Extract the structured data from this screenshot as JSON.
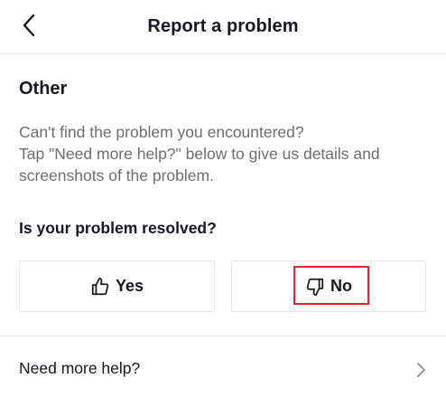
{
  "header": {
    "title": "Report a problem",
    "back_icon": "chevron-left-icon"
  },
  "section": {
    "title": "Other",
    "description_lines": [
      "Can't find the problem you encountered?",
      "Tap \"Need more help?\" below to give us details and",
      "screenshots of the problem."
    ]
  },
  "feedback": {
    "question": "Is your problem resolved?",
    "yes_label": "Yes",
    "yes_icon": "thumbs-up-icon",
    "no_label": "No",
    "no_icon": "thumbs-down-icon",
    "highlight_color": "#e0282a"
  },
  "help": {
    "label": "Need more help?",
    "icon": "chevron-right-icon"
  }
}
